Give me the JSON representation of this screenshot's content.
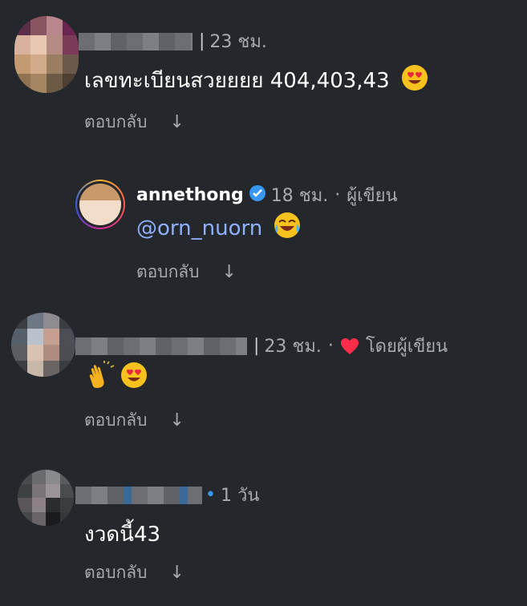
{
  "colors": {
    "background": "#24272b",
    "meta": "#a7abb0",
    "mention": "#8fb0ff",
    "verified": "#3897f0",
    "heart": "#ff2d4a"
  },
  "comments": [
    {
      "time": "23 ชม.",
      "text": "เลขทะเบียนสวยยยย 404,403,43",
      "emoji": "heart-eyes",
      "reply_label": "ตอบกลับ"
    },
    {
      "username": "annethong",
      "time": "18 ชม.",
      "author_label": "ผู้เขียน",
      "mention": "@orn_nuorn",
      "emoji": "laughing-tears",
      "reply_label": "ตอบกลับ"
    },
    {
      "time": "23 ชม.",
      "liked_label": "โดยผู้เขียน",
      "emoji": [
        "clapping-hands",
        "heart-eyes"
      ],
      "reply_label": "ตอบกลับ"
    },
    {
      "time": "1 วัน",
      "text": "งวดนี้43",
      "reply_label": "ตอบกลับ"
    }
  ]
}
